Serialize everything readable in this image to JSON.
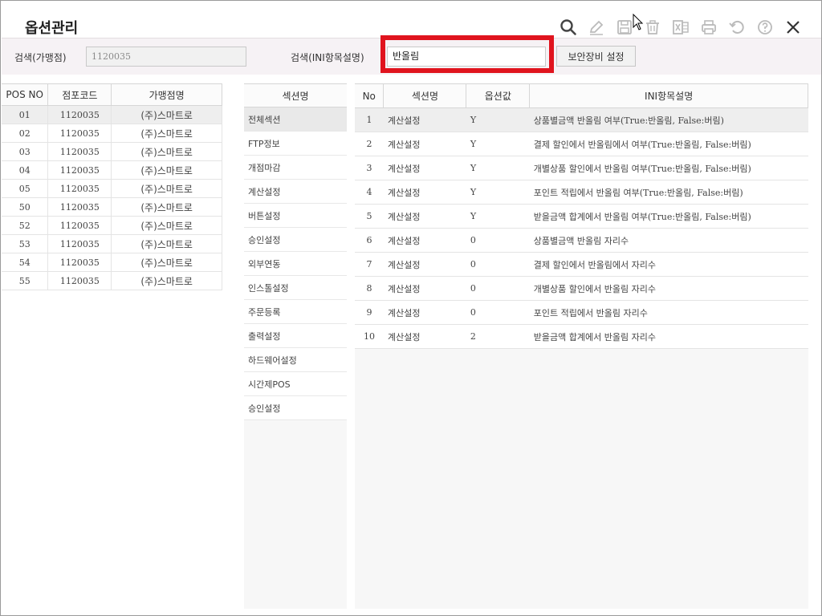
{
  "title": "옵션관리",
  "toolbar": [
    {
      "name": "search-icon",
      "color": "#444444"
    },
    {
      "name": "edit-icon",
      "color": "#bbbbbb"
    },
    {
      "name": "save-icon",
      "color": "#bbbbbb"
    },
    {
      "name": "delete-icon",
      "color": "#bbbbbb"
    },
    {
      "name": "excel-icon",
      "color": "#bbbbbb"
    },
    {
      "name": "print-icon",
      "color": "#bbbbbb"
    },
    {
      "name": "refresh-icon",
      "color": "#bbbbbb"
    },
    {
      "name": "help-icon",
      "color": "#bbbbbb"
    },
    {
      "name": "close-icon",
      "color": "#333333"
    }
  ],
  "search": {
    "store_label": "검색(가맹점)",
    "store_value": "1120035",
    "ini_label": "검색(INI항목설명)",
    "ini_value": "반올림",
    "button_label": "보안장비 설정"
  },
  "pos_table": {
    "headers": [
      "POS NO",
      "점포코드",
      "가맹점명"
    ],
    "rows": [
      [
        "01",
        "1120035",
        "(주)스마트로"
      ],
      [
        "02",
        "1120035",
        "(주)스마트로"
      ],
      [
        "03",
        "1120035",
        "(주)스마트로"
      ],
      [
        "04",
        "1120035",
        "(주)스마트로"
      ],
      [
        "05",
        "1120035",
        "(주)스마트로"
      ],
      [
        "50",
        "1120035",
        "(주)스마트로"
      ],
      [
        "52",
        "1120035",
        "(주)스마트로"
      ],
      [
        "53",
        "1120035",
        "(주)스마트로"
      ],
      [
        "54",
        "1120035",
        "(주)스마트로"
      ],
      [
        "55",
        "1120035",
        "(주)스마트로"
      ]
    ]
  },
  "sections": {
    "header": "섹션명",
    "items": [
      "전체섹션",
      "FTP정보",
      "개점마감",
      "계산설정",
      "버튼설정",
      "승인설정",
      "외부연동",
      "인스톨설정",
      "주문등록",
      "출력설정",
      "하드웨어설정",
      "시간제POS",
      "승인설정"
    ]
  },
  "ini_table": {
    "headers": [
      "No",
      "섹션명",
      "옵션값",
      "INI항목설명"
    ],
    "rows": [
      [
        "1",
        "계산설정",
        "Y",
        "상품별금액 반올림 여부(True:반올림, False:버림)"
      ],
      [
        "2",
        "계산설정",
        "Y",
        "결제 할인에서 반올림에서 여부(True:반올림, False:버림)"
      ],
      [
        "3",
        "계산설정",
        "Y",
        "개별상품 할인에서 반올림 여부(True:반올림, False:버림)"
      ],
      [
        "4",
        "계산설정",
        "Y",
        "포인트 적립에서 반올림 여부(True:반올림, False:버림)"
      ],
      [
        "5",
        "계산설정",
        "Y",
        "받을금액 합계에서 반올림 여부(True:반올림, False:버림)"
      ],
      [
        "6",
        "계산설정",
        "0",
        "상품별금액 반올림 자리수"
      ],
      [
        "7",
        "계산설정",
        "0",
        "결제 할인에서 반올림에서 자리수"
      ],
      [
        "8",
        "계산설정",
        "0",
        "개별상품 할인에서 반올림 자리수"
      ],
      [
        "9",
        "계산설정",
        "0",
        "포인트 적립에서 반올림 자리수"
      ],
      [
        "10",
        "계산설정",
        "2",
        "받을금액 합계에서 반올림 자리수"
      ]
    ]
  },
  "highlight_color": "#e0141e"
}
